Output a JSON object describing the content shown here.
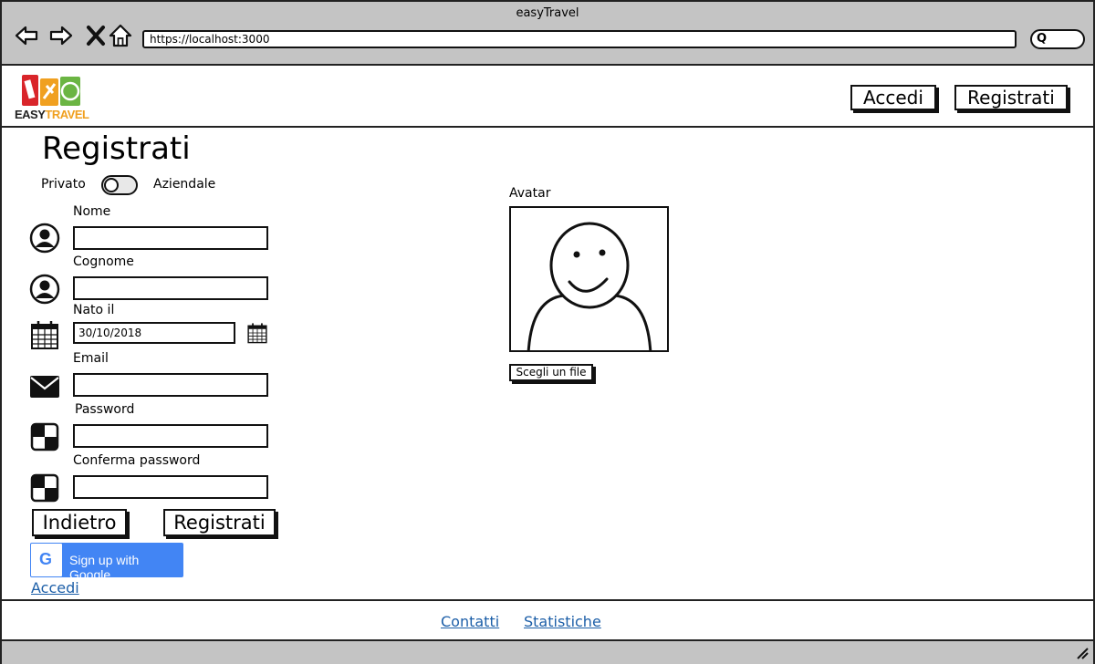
{
  "browser": {
    "window_title": "easyTravel",
    "url": "https://localhost:3000",
    "search_glyph": "Q"
  },
  "header": {
    "logo": {
      "easy": "EASY",
      "travel": "TRAVEL"
    },
    "login_label": "Accedi",
    "register_label": "Registrati"
  },
  "form": {
    "title": "Registrati",
    "toggle": {
      "left_label": "Privato",
      "right_label": "Aziendale",
      "on": false
    },
    "fields": {
      "nome": {
        "label": "Nome",
        "value": ""
      },
      "cognome": {
        "label": "Cognome",
        "value": ""
      },
      "nato_il": {
        "label": "Nato il",
        "value": "30/10/2018"
      },
      "email": {
        "label": "Email",
        "value": ""
      },
      "password": {
        "label": "Password",
        "value": ""
      },
      "conferma_password": {
        "label": "Conferma password",
        "value": ""
      }
    },
    "back_label": "Indietro",
    "submit_label": "Registrati",
    "google": {
      "glyph": "G",
      "label": "Sign up with Google"
    },
    "login_link": "Accedi"
  },
  "avatar": {
    "label": "Avatar",
    "file_button": "Scegli un file"
  },
  "footer": {
    "links": [
      "Contatti",
      "Statistiche"
    ]
  },
  "colors": {
    "chrome_gray": "#c4c4c4",
    "link_blue": "#1d5fa8",
    "google_blue": "#4285f4",
    "logo_orange": "#f0a020"
  }
}
